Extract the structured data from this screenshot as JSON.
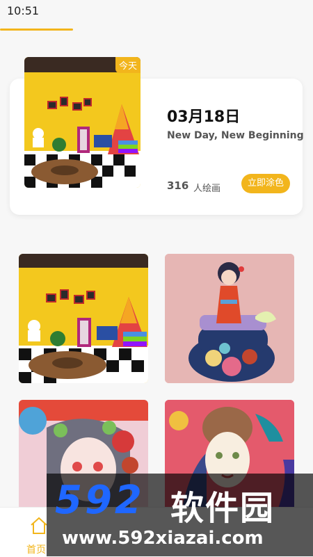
{
  "status_bar": {
    "time": "10:51"
  },
  "daily": {
    "badge": "今天",
    "date": "03月18日",
    "subtitle": "New Day, New Beginning",
    "count": "316",
    "count_label": "人绘画",
    "button_label": "立即涂色"
  },
  "nav": {
    "home_label": "首页"
  },
  "watermark": {
    "logo": "592",
    "brand": "软件园",
    "url": "www.592xiazai.com"
  },
  "colors": {
    "accent": "#f2b51c",
    "watermark_blue": "#1f67ff"
  }
}
